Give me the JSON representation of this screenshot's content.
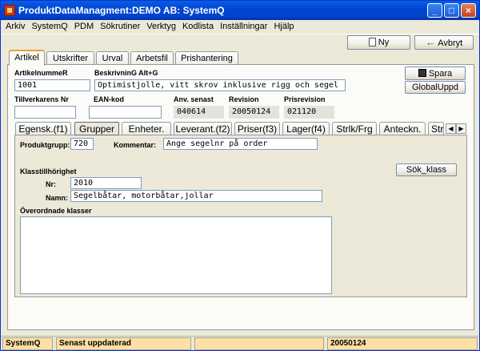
{
  "window": {
    "title": "ProduktDataManagment:DEMO AB: SystemQ"
  },
  "menu": [
    "Arkiv",
    "SystemQ",
    "PDM",
    "Sökrutiner",
    "Verktyg",
    "Kodlista",
    "Inställningar",
    "Hjälp"
  ],
  "toolbar": {
    "new_label": "Ny",
    "cancel_label": "Avbryt"
  },
  "tabs": [
    "Artikel",
    "Utskrifter",
    "Urval",
    "Arbetsfil",
    "Prishantering"
  ],
  "article": {
    "number_label": "ArtikelnummeR",
    "number_value": "1001",
    "desc_label": "BeskrivninG Alt+G",
    "desc_value": "Optimistjolle, vitt skrov inklusive rigg och segel",
    "supplier_no_label": "Tillverkarens Nr",
    "supplier_no_value": "",
    "ean_label": "EAN-kod",
    "ean_value": "",
    "last_used_label": "Anv. senast",
    "last_used_value": "040614",
    "revision_label": "Revision",
    "revision_value": "20050124",
    "price_rev_label": "Prisrevision",
    "price_rev_value": "021120"
  },
  "actions": {
    "save_label": "Spara",
    "global_update_label": "GlobalUppd"
  },
  "inner_tabs": [
    "Egensk.(f1)",
    "Grupper",
    "Enheter.",
    "Leverant.(f2)",
    "Priser(f3)",
    "Lager(f4)",
    "Strlk/Frg",
    "Anteckn.",
    "Str"
  ],
  "groups": {
    "product_group_label": "Produktgrupp:",
    "product_group_value": "720",
    "comment_label": "Kommentar:",
    "comment_value": "Ange segelnr på order",
    "class_section_label": "Klasstillhörighet",
    "search_class_label": "Sök_klass",
    "nr_label": "Nr:",
    "nr_value": "2010",
    "name_label": "Namn:",
    "name_value": "Segelbåtar, motorbåtar,jollar",
    "parent_classes_label": "Överordnade klasser"
  },
  "status": {
    "app": "SystemQ",
    "message": "Senast uppdaterad",
    "date": "20050124"
  }
}
